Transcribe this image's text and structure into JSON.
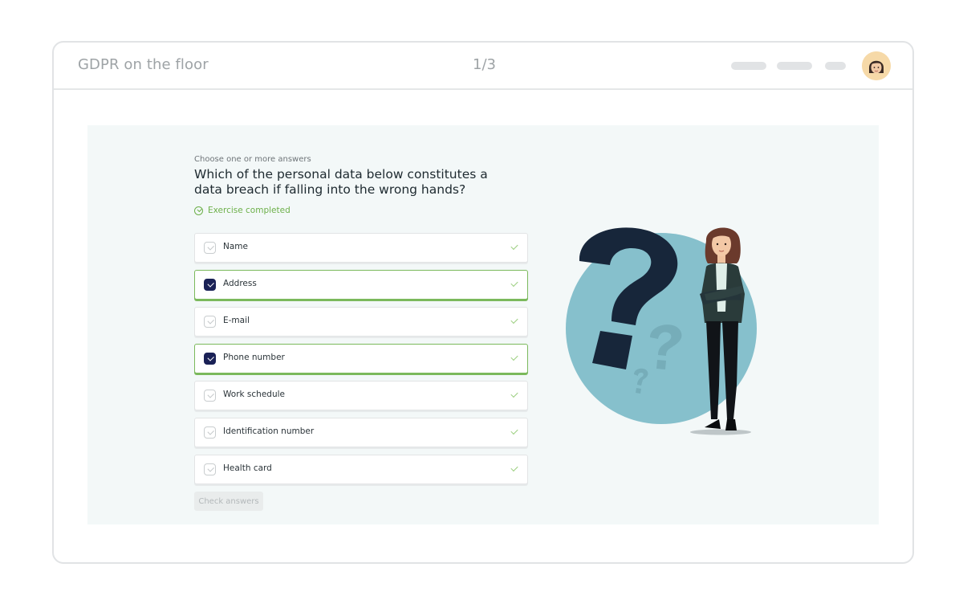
{
  "header": {
    "course_title": "GDPR on the floor",
    "progress": "1/3"
  },
  "exercise": {
    "hint": "Choose one or more answers",
    "question": "Which of the personal data below constitutes a data breach if falling into the wrong hands?",
    "status": "Exercise completed",
    "options": [
      {
        "label": "Name",
        "selected": false
      },
      {
        "label": "Address",
        "selected": true
      },
      {
        "label": "E-mail",
        "selected": false
      },
      {
        "label": "Phone number",
        "selected": true
      },
      {
        "label": "Work schedule",
        "selected": false
      },
      {
        "label": "Identification number",
        "selected": false
      },
      {
        "label": "Health card",
        "selected": false
      }
    ],
    "check_button": "Check answers"
  },
  "colors": {
    "accent_green": "#6db04a",
    "selected_checkbox": "#1a2156",
    "panel_bg": "#f3f8f8",
    "illustration_circle": "#86c0cc",
    "question_mark": "#17263a"
  },
  "icons": [
    "check-circle-icon",
    "checkbox-icon",
    "checkmark-icon",
    "avatar"
  ]
}
